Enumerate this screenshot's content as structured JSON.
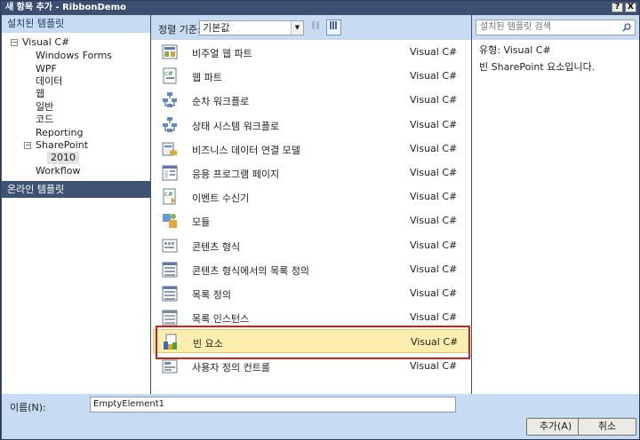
{
  "window": {
    "title": "새 항목 추가 - RibbonDemo",
    "help_label": "?",
    "close_label": "X"
  },
  "left": {
    "installed_header": "설치된 템플릿",
    "tree": [
      {
        "label": "Visual C#",
        "expander": "⊟"
      },
      {
        "label": "Windows Forms"
      },
      {
        "label": "WPF"
      },
      {
        "label": "데이터"
      },
      {
        "label": "웹"
      },
      {
        "label": "일반"
      },
      {
        "label": "코드"
      },
      {
        "label": "Reporting"
      },
      {
        "label": "SharePoint",
        "expander": "⊟"
      },
      {
        "label": "2010",
        "selected": true
      },
      {
        "label": "Workflow"
      }
    ],
    "online_header": "온라인 템플릿"
  },
  "sort": {
    "label": "정렬 기준:",
    "value": "기본값"
  },
  "templates": [
    {
      "name": "비주얼 웹 파트",
      "lang": "Visual C#",
      "icon": "webpart-icon"
    },
    {
      "name": "웹 파트",
      "lang": "Visual C#",
      "icon": "csharp-file-icon"
    },
    {
      "name": "순차 워크플로",
      "lang": "Visual C#",
      "icon": "workflow-icon"
    },
    {
      "name": "상태 시스템 워크플로",
      "lang": "Visual C#",
      "icon": "workflow-icon"
    },
    {
      "name": "비즈니스 데이터 연결 모델",
      "lang": "Visual C#",
      "icon": "bdc-model-icon"
    },
    {
      "name": "응용 프로그램 페이지",
      "lang": "Visual C#",
      "icon": "app-page-icon"
    },
    {
      "name": "이벤트 수신기",
      "lang": "Visual C#",
      "icon": "event-receiver-icon"
    },
    {
      "name": "모듈",
      "lang": "Visual C#",
      "icon": "module-icon"
    },
    {
      "name": "콘텐츠 형식",
      "lang": "Visual C#",
      "icon": "content-type-icon"
    },
    {
      "name": "콘텐츠 형식에서의 목록 정의",
      "lang": "Visual C#",
      "icon": "list-definition-icon"
    },
    {
      "name": "목록 정의",
      "lang": "Visual C#",
      "icon": "list-definition-icon"
    },
    {
      "name": "목록 인스턴스",
      "lang": "Visual C#",
      "icon": "list-instance-icon"
    },
    {
      "name": "빈 요소",
      "lang": "Visual C#",
      "icon": "empty-element-icon",
      "selected": true
    },
    {
      "name": "사용자 정의 컨트롤",
      "lang": "Visual C#",
      "icon": "user-control-icon"
    }
  ],
  "search": {
    "placeholder": "설치된 템플릿 검색"
  },
  "detail": {
    "type": "유형:  Visual C#",
    "description": "빈 SharePoint 요소입니다."
  },
  "bottom": {
    "name_label": "이름(N):",
    "name_value": "EmptyElement1",
    "add_label": "추가(A)",
    "cancel_label": "취소"
  },
  "colors": {
    "title_bar": "#3c4e72",
    "panel_header": "#c7dcf2",
    "online_header": "#3e5273",
    "selected_row": "#fdeeb0",
    "highlight_box": "#cc2020"
  }
}
